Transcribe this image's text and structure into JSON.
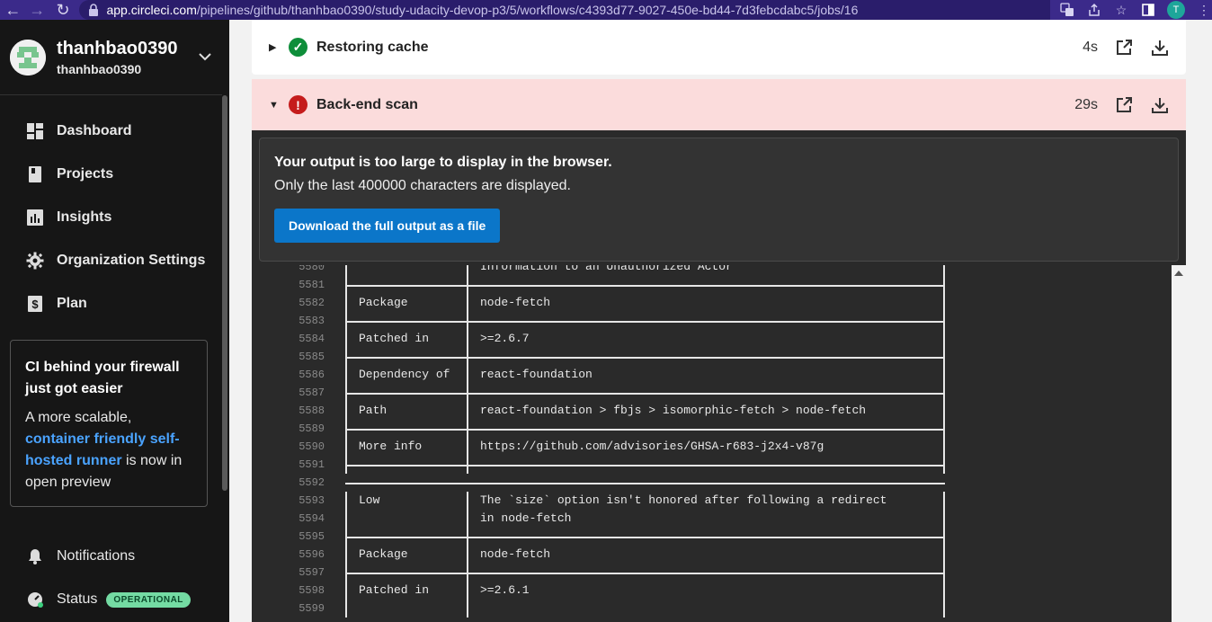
{
  "browser": {
    "url_host": "app.circleci.com",
    "url_path": "/pipelines/github/thanhbao0390/study-udacity-devop-p3/5/workflows/c4393d77-9027-450e-bd44-7d3febcdabc5/jobs/16",
    "profile_initial": "T",
    "accent": "#3b2a8a"
  },
  "org": {
    "name": "thanhbao0390",
    "sub": "thanhbao0390"
  },
  "nav": [
    {
      "label": "Dashboard",
      "icon": "dashboard-icon"
    },
    {
      "label": "Projects",
      "icon": "projects-icon"
    },
    {
      "label": "Insights",
      "icon": "insights-icon"
    },
    {
      "label": "Organization Settings",
      "icon": "gear-icon"
    },
    {
      "label": "Plan",
      "icon": "dollar-icon"
    }
  ],
  "promo": {
    "title": "CI behind your firewall just got easier",
    "body_start": "A more scalable,",
    "link": "container friendly self-hosted runner",
    "body_end": "is now in open preview"
  },
  "bottom_nav": {
    "notifications": "Notifications",
    "status": "Status",
    "status_badge": "OPERATIONAL"
  },
  "steps": {
    "cache": {
      "title": "Restoring cache",
      "duration": "4s",
      "status": "success"
    },
    "scan": {
      "title": "Back-end scan",
      "duration": "29s",
      "status": "failed"
    }
  },
  "output_notice": {
    "title": "Your output is too large to display in the browser.",
    "subtitle": "Only the last 400000 characters are displayed.",
    "download_label": "Download the full output as a file"
  },
  "log": [
    {
      "n": "5580",
      "key": "",
      "val": "Information to an Unauthorized Actor"
    },
    {
      "n": "5581",
      "key": "",
      "val": ""
    },
    {
      "n": "5582",
      "key": "Package",
      "val": "node-fetch"
    },
    {
      "n": "5583",
      "key": "",
      "val": ""
    },
    {
      "n": "5584",
      "key": "Patched in",
      "val": ">=2.6.7"
    },
    {
      "n": "5585",
      "key": "",
      "val": ""
    },
    {
      "n": "5586",
      "key": "Dependency of",
      "val": "react-foundation"
    },
    {
      "n": "5587",
      "key": "",
      "val": ""
    },
    {
      "n": "5588",
      "key": "Path",
      "val": "react-foundation > fbjs > isomorphic-fetch > node-fetch"
    },
    {
      "n": "5589",
      "key": "",
      "val": ""
    },
    {
      "n": "5590",
      "key": "More info",
      "val": "https://github.com/advisories/GHSA-r683-j2x4-v87g"
    },
    {
      "n": "5591",
      "key": "",
      "val": ""
    },
    {
      "n": "5592",
      "key": "",
      "val": ""
    },
    {
      "n": "5593",
      "key": "Low",
      "val": "The `size` option isn't honored after following a redirect"
    },
    {
      "n": "5594",
      "key": "",
      "val": "in node-fetch"
    },
    {
      "n": "5595",
      "key": "",
      "val": ""
    },
    {
      "n": "5596",
      "key": "Package",
      "val": "node-fetch"
    },
    {
      "n": "5597",
      "key": "",
      "val": ""
    },
    {
      "n": "5598",
      "key": "Patched in",
      "val": ">=2.6.1"
    },
    {
      "n": "5599",
      "key": "",
      "val": ""
    }
  ]
}
